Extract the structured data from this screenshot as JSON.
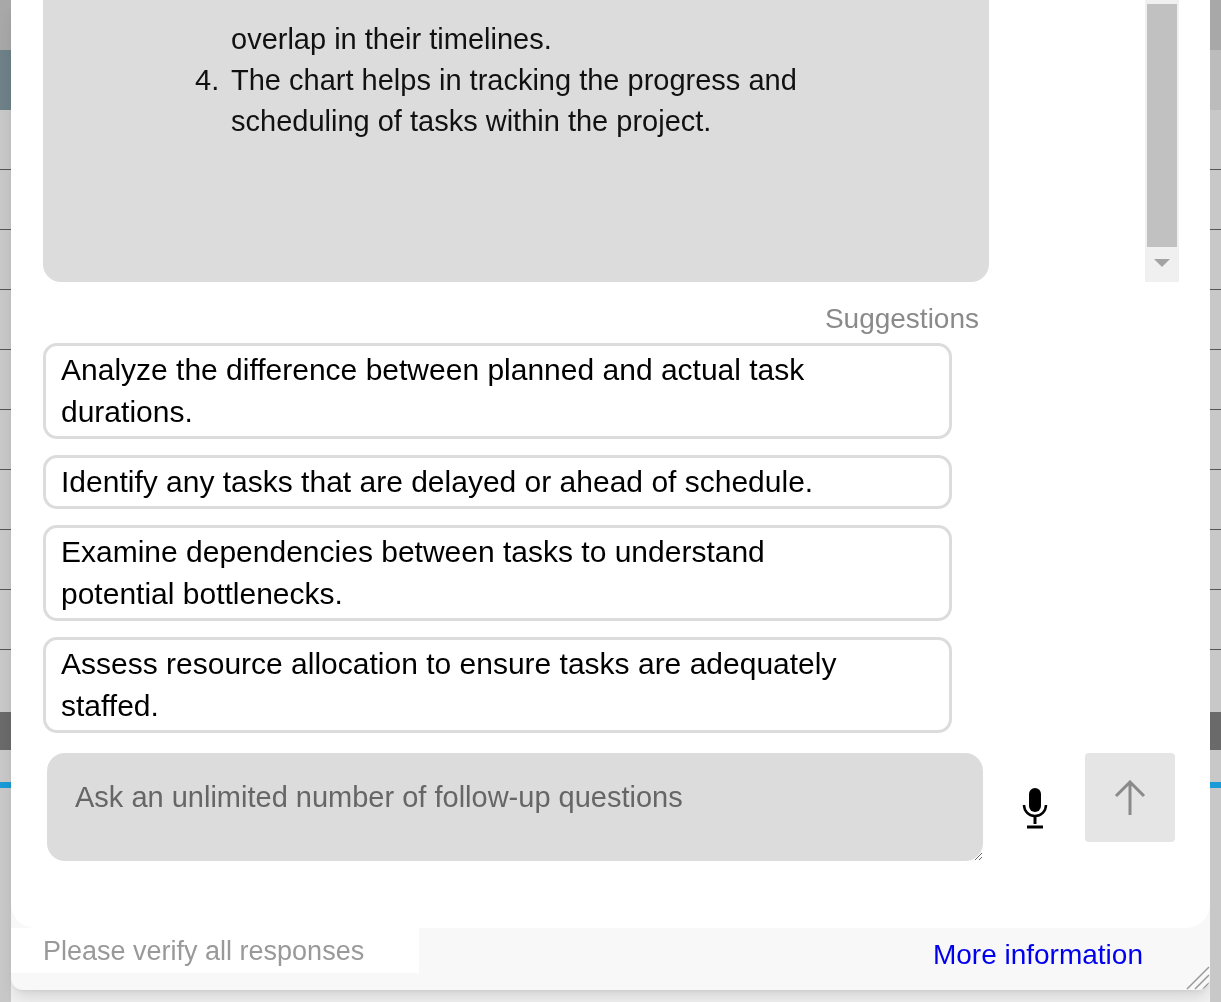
{
  "answer": {
    "items": [
      {
        "text": "overlap in their timelines."
      },
      {
        "number": "4.",
        "text": "The chart helps in tracking the progress and scheduling of tasks within the project."
      }
    ]
  },
  "suggestions": {
    "label": "Suggestions",
    "items": [
      "Analyze the difference between planned and actual task durations.",
      "Identify any tasks that are delayed or ahead of schedule.",
      "Examine dependencies between tasks to understand potential bottlenecks.",
      "Assess resource allocation to ensure tasks are adequately staffed."
    ]
  },
  "input": {
    "placeholder": "Ask an unlimited number of follow-up questions"
  },
  "footer": {
    "note": "Please verify all responses",
    "link": "More information"
  }
}
